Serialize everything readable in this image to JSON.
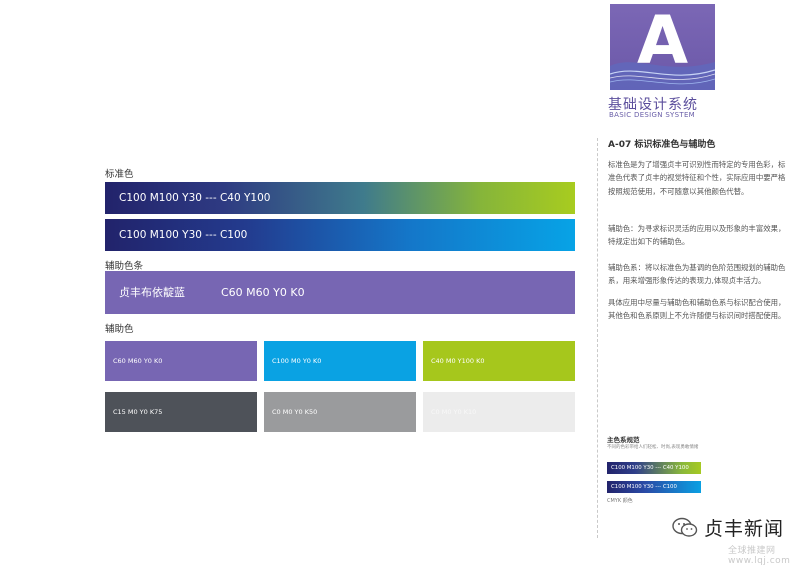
{
  "brand": {
    "logo_letter": "A",
    "title": "基础设计系统",
    "subtitle": "BASIC DESIGN SYSTEM",
    "color": "#6b58a8"
  },
  "main": {
    "standard_label": "标准色",
    "gradient_bars": [
      {
        "text": "C100 M100 Y30  --- C40 Y100"
      },
      {
        "text": "C100 M100 Y30  --- C100"
      }
    ],
    "aux_bar_label": "辅助色条",
    "aux_bar": {
      "name": "贞丰布依靛蓝",
      "code": "C60 M60 Y0  K0",
      "color": "#7766b3"
    },
    "aux_label": "辅助色",
    "swatches": [
      {
        "code": "C60 M60 Y0 K0",
        "color": "#7766b3"
      },
      {
        "code": "C100 M0 Y0 K0",
        "color": "#0aa2e3"
      },
      {
        "code": "C40 M0 Y100 K0",
        "color": "#a6c71c"
      },
      {
        "code": "C15 M0 Y0 K75",
        "color": "#4e5259"
      },
      {
        "code": "C0 M0 Y0 K50",
        "color": "#9a9b9d"
      },
      {
        "code": "C0 M0 Y0 K10",
        "color": "#ececec"
      }
    ]
  },
  "right": {
    "heading": "A-07 标识标准色与辅助色",
    "para1": "标准色是为了增强贞丰可识别性而特定的专用色彩，标准色代表了贞丰的视觉特征和个性，实际应用中要严格按照规范使用，不可随意以其他颜色代替。",
    "para2": "辅助色：为寻求标识灵活的应用以及形象的丰富效果，特规定出如下的辅助色。",
    "para3": "辅助色系：将以标准色为基调的色阶范围规划的辅助色系，用来增强形象传达的表现力,体现贞丰活力。",
    "para4": "具体应用中尽量与辅助色和辅助色系与标识配合使用，其他色和色系原则上不允许随便与标识间时搭配使用。",
    "mini": {
      "heading": "主色系规范",
      "note": "不同的色彩带给人们轻松、时尚,表现勇敢情绪",
      "bar1": "C100 M100 Y30  --- C40 Y100",
      "bar2": "C100 M100 Y30  --- C100",
      "cmyk": "CMYK 颜色"
    }
  },
  "watermark": {
    "text": "贞丰新闻",
    "url": "全球推建网 www.lqj.com"
  }
}
